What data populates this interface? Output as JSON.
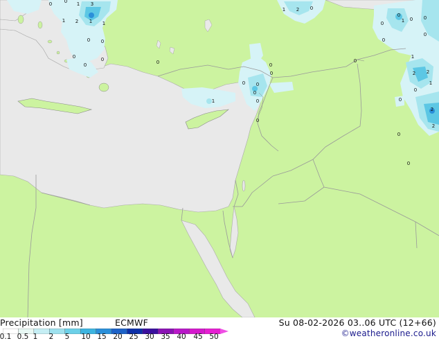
{
  "map": {
    "colors": {
      "land": "#ccf3a0",
      "sea": "#e9e9e9",
      "border": "#999999",
      "precip_light": "#d6f3f7",
      "precip_mid": "#a6e5ee",
      "precip_heavy": "#5cc7e4",
      "precip_core": "#2a8fd9"
    },
    "precip_labels": [
      "1",
      "3",
      "1",
      "2",
      "1",
      "1",
      "0",
      "0",
      "0",
      "0",
      "0",
      "0",
      "0",
      "0",
      "1",
      "2",
      "0",
      "1",
      "0",
      "0",
      "0",
      "0",
      "0",
      "1",
      "0",
      "0",
      "0",
      "0",
      "0",
      "0",
      "0",
      "0",
      "1",
      "2",
      "2",
      "1",
      "2",
      "0",
      "2",
      "0",
      "0",
      "0",
      "0"
    ]
  },
  "footer": {
    "product_label": "Precipitation [mm]",
    "model_label": "ECMWF",
    "valid_time": "Su 08-02-2026 03..06 UTC (12+66)",
    "credit": "©weatheronline.co.uk",
    "legend_ticks": [
      "0.1",
      "0.5",
      "1",
      "2",
      "5",
      "10",
      "15",
      "20",
      "25",
      "30",
      "35",
      "40",
      "45",
      "50"
    ],
    "legend_colors": [
      "#ffffff",
      "#e8f8f4",
      "#c5eef4",
      "#9ee1ee",
      "#6cd0e8",
      "#3db4e0",
      "#2a8fd9",
      "#1d62c7",
      "#0c2fa8",
      "#3a0f9e",
      "#8a12b4",
      "#b818c8",
      "#d419cc",
      "#e61fd2",
      "#ef4fe4"
    ]
  }
}
